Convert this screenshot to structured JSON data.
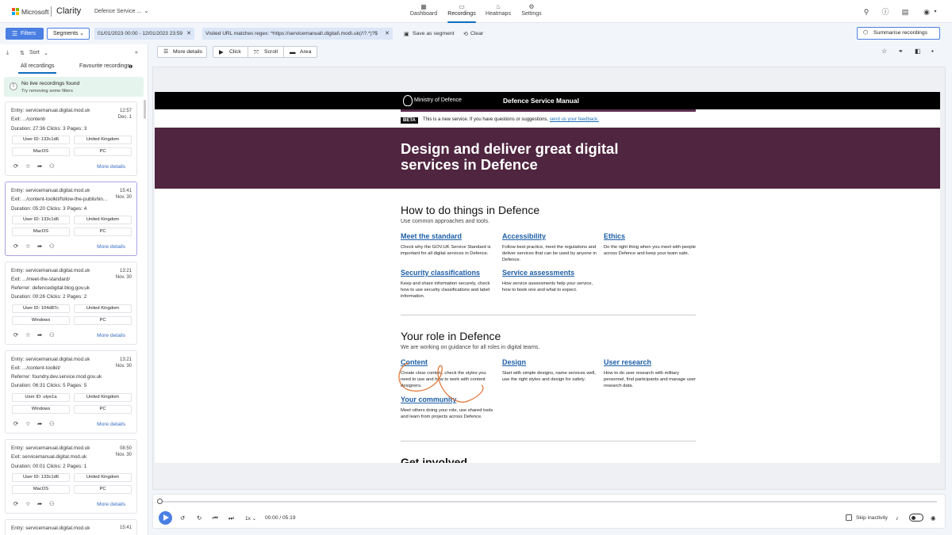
{
  "topnav": {
    "brand": "Microsoft",
    "app": "Clarity",
    "project": "Defence Service ...",
    "items": [
      {
        "label": "Dashboard",
        "icon": "dashboard-icon"
      },
      {
        "label": "Recordings",
        "icon": "video-icon"
      },
      {
        "label": "Heatmaps",
        "icon": "flame-icon"
      },
      {
        "label": "Settings",
        "icon": "gear-icon"
      }
    ]
  },
  "filterbar": {
    "filters_label": "Filters",
    "segments_label": "Segments",
    "date_range": "01/01/2023 00:00 - 12/01/2023 23:59",
    "url_filter": "Visited URL matches regex: ^https://servicemanual\\.digital\\.mod\\.uk(/\\?.*)?$",
    "save_segment": "Save as segment",
    "clear": "Clear",
    "summarise": "Summarise recordings"
  },
  "leftpanel": {
    "sort_label": "Sort",
    "tabs": [
      "All recordings",
      "Favourite recordings"
    ],
    "notice_title": "No live recordings found",
    "notice_sub": "Try removing some filters",
    "more_details": "More details",
    "cards": [
      {
        "entry": "Entry: servicemanual.digital.mod.uk",
        "exit": "Exit: .../content/",
        "extra": "",
        "stats": "Duration: 27:36   Clicks: 3   Pages: 3",
        "time": "12:57",
        "date": "Dec. 1",
        "user": "User ID: 133c1d6",
        "country": "United Kingdom",
        "os": "MacOS",
        "device": "PC"
      },
      {
        "entry": "Entry: servicemanual.digital.mod.uk",
        "exit": "Exit: .../content-toolkit/follow-the-publishin...",
        "extra": "",
        "stats": "Duration: 05:20   Clicks: 3   Pages: 4",
        "time": "15:41",
        "date": "Nov. 30",
        "user": "User ID: 133c1d6",
        "country": "United Kingdom",
        "os": "MacOS",
        "device": "PC"
      },
      {
        "entry": "Entry: servicemanual.digital.mod.uk",
        "exit": "Exit: .../meet-the-standard/",
        "extra": "Referrer: defencedigital.blog.gov.uk",
        "stats": "Duration: 00:26   Clicks: 2   Pages: 2",
        "time": "13:21",
        "date": "Nov. 30",
        "user": "User ID: 104d87c",
        "country": "United Kingdom",
        "os": "Windows",
        "device": "PC"
      },
      {
        "entry": "Entry: servicemanual.digital.mod.uk",
        "exit": "Exit: .../content-toolkit/",
        "extra": "Referrer: foundry.dev.service.mod.gov.uk",
        "stats": "Duration: 06:31   Clicks: 5   Pages: 5",
        "time": "13:21",
        "date": "Nov. 30",
        "user": "User ID: utye1a",
        "country": "United Kingdom",
        "os": "Windows",
        "device": "PC"
      },
      {
        "entry": "Entry: servicemanual.digital.mod.uk",
        "exit": "Exit: servicemanual.digital.mod.uk",
        "extra": "",
        "stats": "Duration: 00:01   Clicks: 2   Pages: 1",
        "time": "08:50",
        "date": "Nov. 30",
        "user": "User ID: 133c1d6",
        "country": "United Kingdom",
        "os": "MacOS",
        "device": "PC"
      },
      {
        "entry": "Entry: servicemanual.digital.mod.uk",
        "time": "15:41"
      }
    ]
  },
  "toolbar": {
    "more_details": "More details",
    "click": "Click",
    "scroll": "Scroll",
    "area": "Area"
  },
  "site": {
    "org": "Ministry of Defence",
    "title": "Defence Service Manual",
    "beta_tag": "BETA",
    "beta_text": "This is a new service. If you have questions or suggestions,",
    "beta_link": "send us your feedback.",
    "hero_title": "Design and deliver great digital services in Defence",
    "section1_title": "How to do things in Defence",
    "section1_sub": "Use common approaches and tools.",
    "items1": [
      {
        "title": "Meet the standard",
        "desc": "Check why the GOV.UK Service Standard is important for all digital services in Defence."
      },
      {
        "title": "Accessibility",
        "desc": "Follow best practice, meet the regulations and deliver services that can be used by anyone in Defence."
      },
      {
        "title": "Ethics",
        "desc": "Do the right thing when you meet with people across Defence and keep your team safe."
      },
      {
        "title": "Security classifications",
        "desc": "Keep and share information securely, check how to use security classifications and label information."
      },
      {
        "title": "Service assessments",
        "desc": "How service assessments help your service, how to book one and what to expect."
      }
    ],
    "section2_title": "Your role in Defence",
    "section2_sub": "We are working on guidance for all roles in digital teams.",
    "items2": [
      {
        "title": "Content",
        "desc": "Create clear content, check the styles you need to use and how to work with content designers."
      },
      {
        "title": "Design",
        "desc": "Start with simple designs, name services well, use the right styles and design for safety."
      },
      {
        "title": "User research",
        "desc": "How to do user research with military personnel, find participants and manage user research data."
      },
      {
        "title": "Your community",
        "desc": "Meet others doing your role, use shared tools and learn from projects across Defence."
      }
    ],
    "section3_title": "Get involved"
  },
  "playback": {
    "speed": "1x",
    "time": "00:00 / 05:19",
    "skip_inactivity": "Skip inactivity"
  }
}
